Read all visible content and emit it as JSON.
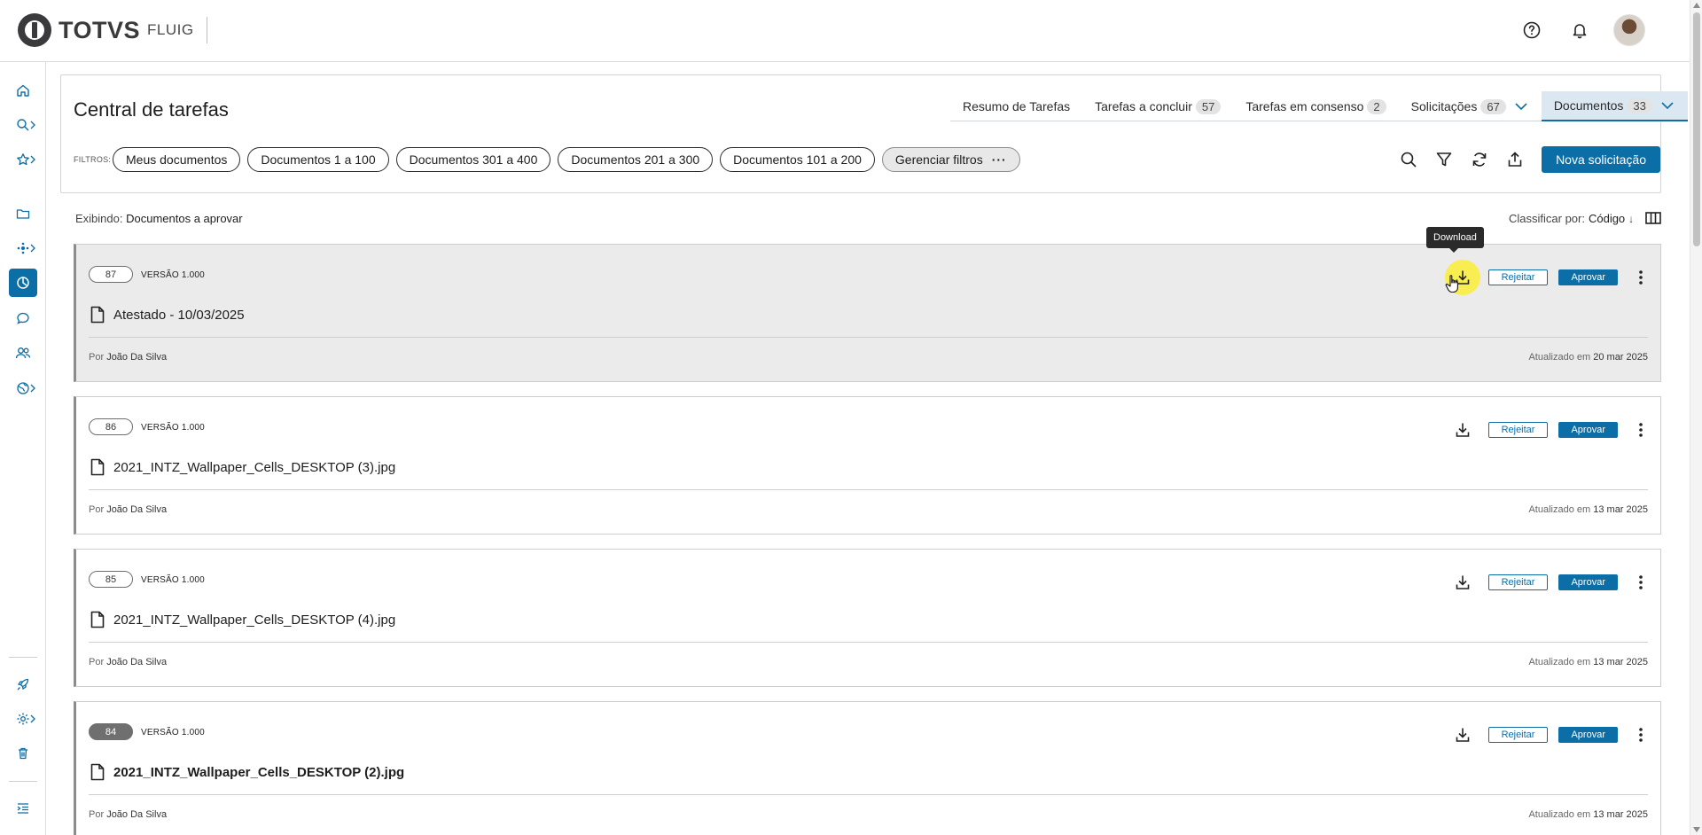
{
  "brand": {
    "name": "TOTVS",
    "product": "FLUIG"
  },
  "header_icons": {
    "help": "help-icon",
    "notifications": "bell-icon",
    "avatar": "user-avatar"
  },
  "sidebar": {
    "items": [
      "home-icon",
      "search-icon",
      "star-icon",
      "folder-icon",
      "process-icon",
      "task-central-icon",
      "chat-icon",
      "community-icon",
      "global-icon"
    ],
    "bottom_items": [
      "rocket-icon",
      "gear-icon",
      "trash-icon",
      "menu-toggle-icon"
    ]
  },
  "page": {
    "title": "Central de tarefas",
    "tabs": [
      {
        "label": "Resumo de Tarefas",
        "count": ""
      },
      {
        "label": "Tarefas a concluir",
        "count": "57"
      },
      {
        "label": "Tarefas em consenso",
        "count": "2"
      },
      {
        "label": "Solicitações",
        "count": "67"
      },
      {
        "label": "Documentos",
        "count": "33"
      }
    ],
    "filters_label": "FILTROS:",
    "filters": [
      "Meus documentos",
      "Documentos 1 a 100",
      "Documentos 301 a 400",
      "Documentos 201 a 300",
      "Documentos 101 a 200"
    ],
    "manage_filters": "Gerenciar filtros",
    "new_request": "Nova solicitação"
  },
  "listing": {
    "showing_label": "Exibindo:",
    "showing_value": "Documentos a aprovar",
    "sort_label": "Classificar por:",
    "sort_value": "Código"
  },
  "tooltip": "Download",
  "documents": [
    {
      "code": "87",
      "version": "VERSÃO 1.000",
      "name": "Atestado - 10/03/2025",
      "author_prefix": "Por",
      "author": "João Da Silva",
      "updated_prefix": "Atualizado em",
      "updated": "20 mar 2025",
      "reject": "Rejeitar",
      "approve": "Aprovar"
    },
    {
      "code": "86",
      "version": "VERSÃO 1.000",
      "name": "2021_INTZ_Wallpaper_Cells_DESKTOP (3).jpg",
      "author_prefix": "Por",
      "author": "João Da Silva",
      "updated_prefix": "Atualizado em",
      "updated": "13 mar 2025",
      "reject": "Rejeitar",
      "approve": "Aprovar"
    },
    {
      "code": "85",
      "version": "VERSÃO 1.000",
      "name": "2021_INTZ_Wallpaper_Cells_DESKTOP (4).jpg",
      "author_prefix": "Por",
      "author": "João Da Silva",
      "updated_prefix": "Atualizado em",
      "updated": "13 mar 2025",
      "reject": "Rejeitar",
      "approve": "Aprovar"
    },
    {
      "code": "84",
      "version": "VERSÃO 1.000",
      "name": "2021_INTZ_Wallpaper_Cells_DESKTOP (2).jpg",
      "author_prefix": "Por",
      "author": "João Da Silva",
      "updated_prefix": "Atualizado em",
      "updated": "13 mar 2025",
      "reject": "Rejeitar",
      "approve": "Aprovar"
    }
  ],
  "colors": {
    "primary": "#0c6ea7",
    "highlight": "#fcee36",
    "hover_card": "#ebebeb"
  }
}
